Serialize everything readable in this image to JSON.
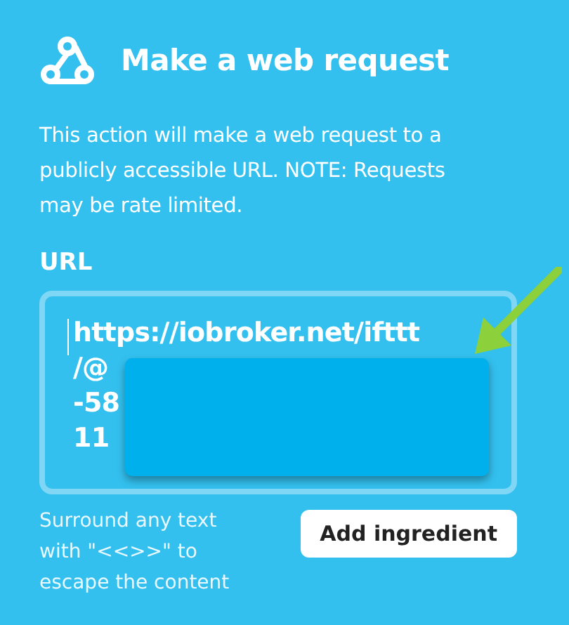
{
  "header": {
    "title": "Make a web request"
  },
  "description": "This action will make a web request to a publicly accessible URL. NOTE: Requests may be rate limited.",
  "url_field": {
    "label": "URL",
    "value_lines": [
      "https://iobroker.net/ifttt",
      "/@",
      "-58",
      "11"
    ],
    "redacted": true
  },
  "hint": "Surround any text with \"<<>>\" to escape the content",
  "add_ingredient_button": "Add ingredient"
}
